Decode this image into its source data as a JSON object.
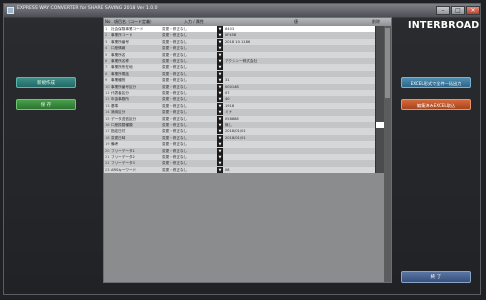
{
  "window": {
    "title": "EXPRESS WAY CONVERTER for SHARE SAVING 2018 Ver 1.0.0"
  },
  "left_panel": {
    "new_button": "新規作成",
    "save_button": "保 存"
  },
  "right_panel": {
    "logo": "INTERBROAD",
    "export_button": "EXCEL形式で全件一括出力",
    "import_button": "編集済みEXCEL取込",
    "close_button": "終 了"
  },
  "table": {
    "headers": [
      "No",
      "項目名（コード定義）",
      "入力 / 属性",
      "値",
      "削除"
    ],
    "rows": [
      {
        "no": "1",
        "name": "社会保険事業コード",
        "attr": "変更・修正なし",
        "value": "8403",
        "checked": false
      },
      {
        "no": "2",
        "name": "事業所コード",
        "attr": "変更・修正なし",
        "value": "0F458",
        "checked": false
      },
      {
        "no": "3",
        "name": "事業所番号",
        "attr": "変更・修正なし",
        "value": "2018 10 1186",
        "checked": false
      },
      {
        "no": "4",
        "name": "口座情報",
        "attr": "変更・修正なし",
        "value": "",
        "checked": false
      },
      {
        "no": "5",
        "name": "事業所名",
        "attr": "変更・修正なし",
        "value": "",
        "checked": false
      },
      {
        "no": "6",
        "name": "事業所名称",
        "attr": "変更・修正なし",
        "value": "アクシン一株式会社",
        "checked": false
      },
      {
        "no": "7",
        "name": "事業所所在地",
        "attr": "変更・修正なし",
        "value": "",
        "checked": false
      },
      {
        "no": "8",
        "name": "事業所電話",
        "attr": "変更・修正なし",
        "value": "",
        "checked": false
      },
      {
        "no": "9",
        "name": "事業種別",
        "attr": "変更・修正なし",
        "value": "31",
        "checked": false
      },
      {
        "no": "10",
        "name": "事業所番号区分",
        "attr": "変更・修正なし",
        "value": "000148",
        "checked": false
      },
      {
        "no": "11",
        "name": "代表者区分",
        "attr": "変更・修正なし",
        "value": "07",
        "checked": false
      },
      {
        "no": "12",
        "name": "年金事務所",
        "attr": "変更・修正なし",
        "value": "40",
        "checked": false
      },
      {
        "no": "13",
        "name": "基準",
        "attr": "変更・修正なし",
        "value": "1918",
        "checked": false
      },
      {
        "no": "14",
        "name": "適用区分",
        "attr": "変更・修正なし",
        "value": "ミナ",
        "checked": false
      },
      {
        "no": "15",
        "name": "データ送信区分",
        "attr": "変更・修正なし",
        "value": "058888",
        "checked": false
      },
      {
        "no": "16",
        "name": "口座振替種類",
        "attr": "変更・修正なし",
        "value": "無し",
        "checked": true
      },
      {
        "no": "17",
        "name": "指定日付",
        "attr": "変更・修正なし",
        "value": "2018/01/01",
        "checked": false
      },
      {
        "no": "18",
        "name": "変更日時",
        "attr": "変更・修正なし",
        "value": "2018/01/01",
        "checked": false
      },
      {
        "no": "19",
        "name": "備考",
        "attr": "変更・修正なし",
        "value": "",
        "checked": false
      },
      {
        "no": "20",
        "name": "フリーデータ1",
        "attr": "変更・修正なし",
        "value": "",
        "checked": false
      },
      {
        "no": "21",
        "name": "フリーデータ2",
        "attr": "変更・修正なし",
        "value": "",
        "checked": false
      },
      {
        "no": "22",
        "name": "フリーデータ3",
        "attr": "変更・修正なし",
        "value": "",
        "checked": false
      },
      {
        "no": "23",
        "name": "ARSキーワード",
        "attr": "変更・修正なし",
        "value": "08",
        "checked": false
      }
    ]
  }
}
